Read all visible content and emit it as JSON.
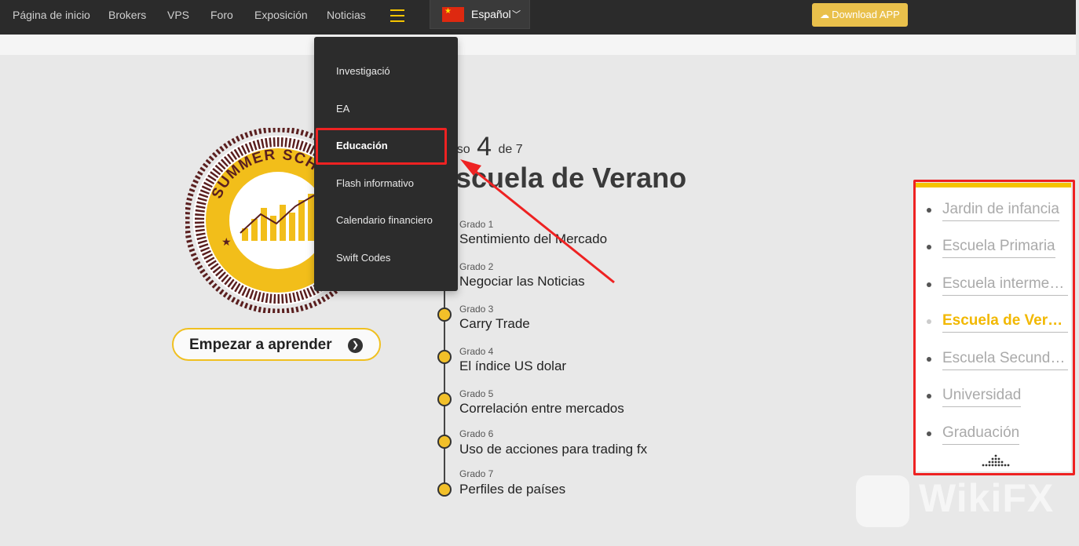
{
  "nav": {
    "links": [
      "Página de inicio",
      "Brokers",
      "VPS",
      "Foro",
      "Exposición",
      "Noticias"
    ],
    "language": "Español",
    "download_label": "Download APP"
  },
  "dropdown": {
    "items": [
      "Investigació",
      "EA",
      "Educación",
      "Flash informativo",
      "Calendario financiero",
      "Swift Codes"
    ],
    "active_index": 2
  },
  "badge": {
    "text": "SUMMER SCHOOL",
    "stars": [
      "★",
      "★"
    ]
  },
  "start_button": {
    "label": "Empezar a aprender",
    "icon": "chevron-right-icon"
  },
  "course": {
    "prefix": "Curso",
    "number": "4",
    "suffix": "de 7",
    "title": "Escuela de Verano"
  },
  "grades": [
    {
      "grade": "Grado 1",
      "name": "Sentimiento del Mercado"
    },
    {
      "grade": "Grado 2",
      "name": "Negociar las Noticias"
    },
    {
      "grade": "Grado 3",
      "name": "Carry Trade"
    },
    {
      "grade": "Grado 4",
      "name": "El índice US dolar"
    },
    {
      "grade": "Grado 5",
      "name": "Correlación entre mercados"
    },
    {
      "grade": "Grado 6",
      "name": "Uso de acciones para trading fx"
    },
    {
      "grade": "Grado 7",
      "name": "Perfiles de países"
    }
  ],
  "levels": {
    "items": [
      "Jardin de infancia",
      "Escuela Primaria",
      "Escuela intermedia",
      "Escuela de Verano",
      "Escuela Secundaria",
      "Universidad",
      "Graduación"
    ],
    "active_index": 3
  },
  "watermark": "WikiFX",
  "colors": {
    "nav_bg": "#2b2b2b",
    "accent": "#f5c400",
    "highlight": "#ee2222",
    "download_bg": "#e9c04b"
  }
}
